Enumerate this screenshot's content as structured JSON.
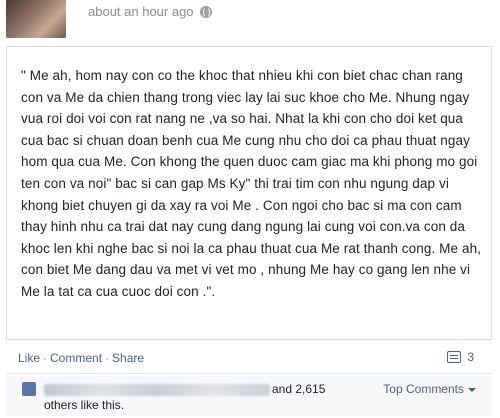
{
  "post": {
    "time": "about an hour ago",
    "text": "\" Me ah, hom nay con co the khoc that nhieu khi con biet chac chan rang con va Me da chien thang trong viec lay lai suc khoe cho Me. Nhung ngay vua roi doi voi con rat nang ne ,va so hai. Nhat la khi con cho doi ket qua cua bac si chuan doan benh cua Me cung nhu cho doi ca phau thuat ngay hom qua cua Me. Con khong the quen duoc cam giac ma khi phong mo goi ten con va noi\" bac si can gap Ms Ky\" thi trai tim con nhu ngung dap vi khong biet chuyen gi da xay ra voi Me . Con ngoi cho bac si ma con cam thay hinh nhu ca trai dat nay cung dang ngung lai cung voi con.va con da khoc len khi nghe bac si noi la ca phau thuat cua Me rat thanh cong. Me ah, con biet Me dang dau va met vi vet mo , nhung Me hay co gang len nhe vi Me la tat ca cua cuoc doi con .\"."
  },
  "actions": {
    "like": "Like",
    "comment": "Comment",
    "share": "Share",
    "separator": "·",
    "comment_count": "3"
  },
  "likes": {
    "count_text": "and 2,615",
    "suffix_text": "others like this.",
    "top_comments_label": "Top Comments"
  },
  "icons": {
    "privacy": "globe-icon",
    "comments": "comment-icon",
    "like": "thumbs-up-icon",
    "dropdown": "caret-down-icon"
  },
  "colors": {
    "link": "#4b5f8f",
    "text": "#1d2129",
    "meta": "#8e8e8e",
    "border": "#d8dde6"
  }
}
